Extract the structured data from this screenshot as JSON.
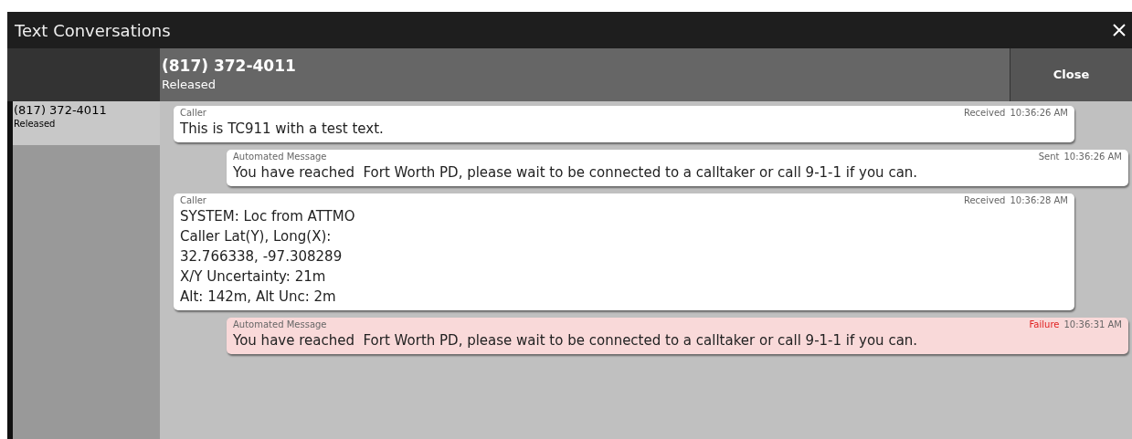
{
  "window": {
    "title": "Text Conversations"
  },
  "header": {
    "number": "(817) 372-4011",
    "status": "Released",
    "close_button": "Close"
  },
  "conversations": [
    {
      "number": "(817) 372-4011",
      "status": "Released",
      "selected": true
    }
  ],
  "messages": [
    {
      "kind": "incoming",
      "sender": "Caller",
      "status": "Received",
      "time": "10:36:26 AM",
      "failed": false,
      "lines": [
        "This is TC911 with a test text."
      ]
    },
    {
      "kind": "outgoing",
      "sender": "Automated Message",
      "status": "Sent",
      "time": "10:36:26 AM",
      "failed": false,
      "lines": [
        "You have reached  Fort Worth PD, please wait to be connected to a calltaker or call 9-1-1 if you can."
      ]
    },
    {
      "kind": "incoming",
      "sender": "Caller",
      "status": "Received",
      "time": "10:36:28 AM",
      "failed": false,
      "lines": [
        "SYSTEM: Loc from ATTMO",
        "Caller Lat(Y), Long(X):",
        "32.766338, -97.308289",
        "X/Y Uncertainty: 21m",
        "Alt: 142m, Alt Unc: 2m"
      ]
    },
    {
      "kind": "outgoing",
      "sender": "Automated Message",
      "status": "Failure",
      "time": "10:36:31 AM",
      "failed": true,
      "lines": [
        "You have reached  Fort Worth PD, please wait to be connected to a calltaker or call 9-1-1 if you can."
      ]
    }
  ]
}
